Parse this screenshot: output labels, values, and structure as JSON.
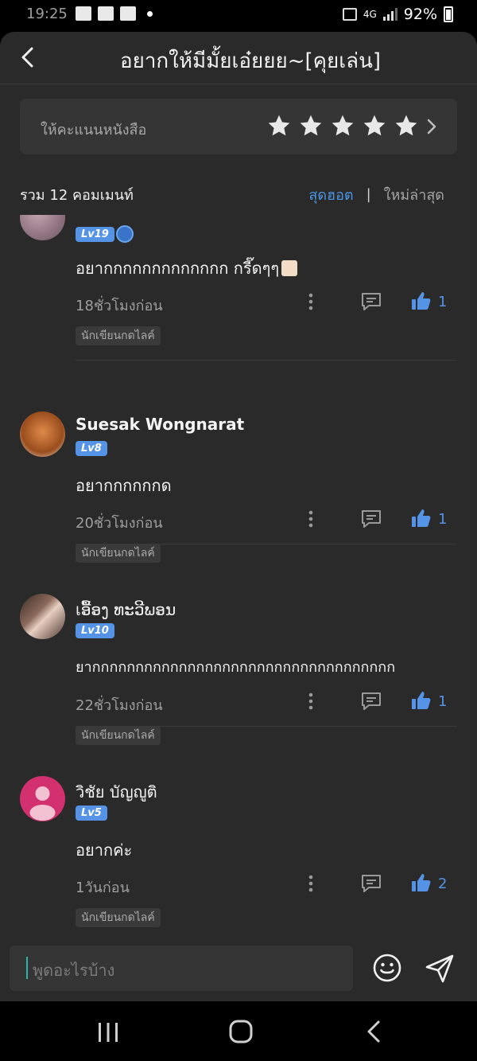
{
  "status_bar": {
    "time": "19:25",
    "battery": "92%",
    "network": "4G"
  },
  "header": {
    "title": "อยากให้มีมั้ยเอ๋ยยย~[คุยเล่น]"
  },
  "rating": {
    "label": "ให้คะแนนหนังสือ",
    "stars": 5
  },
  "comments_header": {
    "count_label": "รวม 12 คอมเมนท์",
    "sort_hot": "สุดฮอต",
    "sort_sep": "|",
    "sort_new": "ใหม่ล่าสุด"
  },
  "comments": [
    {
      "username": "",
      "level": "Lv19",
      "text": "อยากกกกกกกกกกกกก กรี๊ดๆๆ",
      "time": "18ชั่วโมงก่อน",
      "likes": "1",
      "tag": "นักเขียนกดไลค์"
    },
    {
      "username": "Suesak Wongnarat",
      "level": "Lv8",
      "text": "อยากกกกกกด",
      "time": "20ชั่วโมงก่อน",
      "likes": "1",
      "tag": "นักเขียนกดไลค์"
    },
    {
      "username": "เອື້ອງ ທະວີພອນ",
      "level": "Lv10",
      "text": "ยากกกกกกกกกกกกกกกกกกกกกกกกกกกกกกกกกกก",
      "time": "22ชั่วโมงก่อน",
      "likes": "1",
      "tag": "นักเขียนกดไลค์"
    },
    {
      "username": "วิชัย บัญญูติ",
      "level": "Lv5",
      "text": "อยากค่ะ",
      "time": "1วันก่อน",
      "likes": "2",
      "tag": "นักเขียนกดไลค์"
    }
  ],
  "input": {
    "placeholder": "พูดอะไรบ้าง"
  },
  "colors": {
    "accent": "#5593e6",
    "background": "#2a2a2a"
  }
}
